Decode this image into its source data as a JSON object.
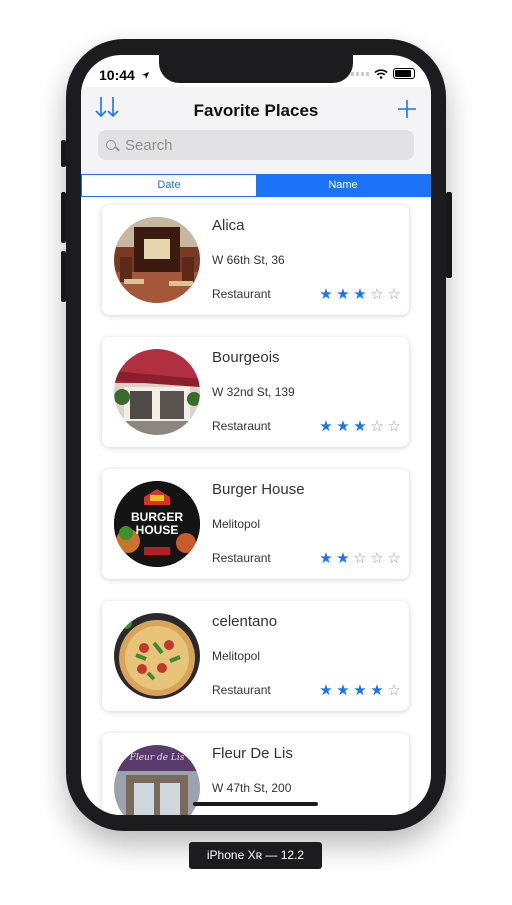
{
  "status_bar": {
    "time": "10:44"
  },
  "nav": {
    "title": "Favorite Places",
    "sort_icon": "sort-arrows-icon",
    "add_icon": "plus-icon"
  },
  "search": {
    "placeholder": "Search"
  },
  "segmented": {
    "items": [
      "Date",
      "Name"
    ],
    "selected": "Name"
  },
  "places": [
    {
      "name": "Alica",
      "location": "W 66th St, 36",
      "type": "Restaurant",
      "rating": 3,
      "max_rating": 5
    },
    {
      "name": "Bourgeois",
      "location": "W 32nd St, 139",
      "type": "Restaraunt",
      "rating": 3,
      "max_rating": 5
    },
    {
      "name": "Burger House",
      "location": "Melitopol",
      "type": "Restaurant",
      "rating": 2,
      "max_rating": 5
    },
    {
      "name": "celentano",
      "location": "Melitopol",
      "type": "Restaurant",
      "rating": 4,
      "max_rating": 5
    },
    {
      "name": "Fleur De Lis",
      "location": "W 47th St, 200",
      "type": "",
      "rating": 0,
      "max_rating": 5
    }
  ],
  "burger_logo_text": [
    "BURGER",
    "HOUSE"
  ],
  "fleur_sign_text": "Fleur de Lis",
  "device_label": "iPhone Xʀ — 12.2",
  "colors": {
    "accent": "#1a73f8",
    "navbar_bg": "#f4f4f6",
    "search_bg": "#e2e2e5",
    "device": "#1c1c1e"
  }
}
